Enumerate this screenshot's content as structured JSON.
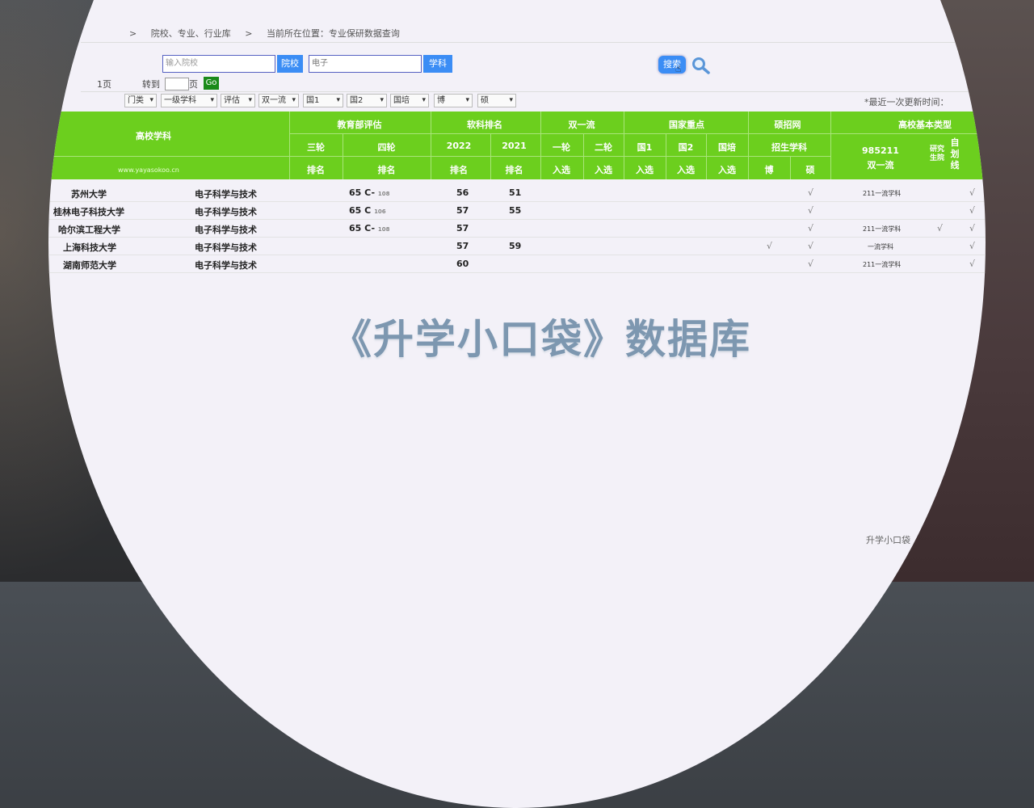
{
  "breadcrumb": {
    "sep1": ">",
    "item1": "院校、专业、行业库",
    "sep2": ">",
    "item2": "当前所在位置：专业保研数据查询"
  },
  "search": {
    "school_placeholder": "输入院校",
    "school_button": "院校",
    "major_value": "电子",
    "major_button": "学科",
    "search_button": "搜索"
  },
  "pager": {
    "page_label": "1页",
    "goto_label": "转到",
    "page_unit": "页",
    "go_button": "Go"
  },
  "filters": [
    "门类",
    "一级学科",
    "评估",
    "双一流",
    "国1",
    "国2",
    "国培",
    "博",
    "硕"
  ],
  "update_label": "*最近一次更新时间：",
  "table": {
    "col_school_major": "高校学科",
    "group_moe": "教育部评估",
    "group_ruanke": "软科排名",
    "group_double": "双一流",
    "group_national": "国家重点",
    "group_shuozhao": "硕招网",
    "group_basic": "高校基本类型",
    "sub_round3": "三轮",
    "sub_round4": "四轮",
    "sub_2022": "2022",
    "sub_2021": "2021",
    "sub_d1": "一轮",
    "sub_d2": "二轮",
    "sub_n1": "国1",
    "sub_n2": "国2",
    "sub_n3": "国培",
    "sub_enroll": "招生学科",
    "sub_985": "985211",
    "sub_double": "双一流",
    "sub_grad": "研究生院",
    "sub_self": "自划线",
    "r_rank1": "排名",
    "r_rank2": "排名",
    "r_rank3": "排名",
    "r_rank4": "排名",
    "r_sel1": "入选",
    "r_sel2": "入选",
    "r_sel3": "入选",
    "r_sel4": "入选",
    "r_sel5": "入选",
    "r_bo": "博",
    "r_shuo": "硕",
    "website": "www.yayasokoo.cn"
  },
  "rows": [
    {
      "school": "苏州大学",
      "major": "电子科学与技术",
      "r4": "65 C-",
      "r4_small": "108",
      "y2022": "56",
      "y2021": "51",
      "bo": "",
      "shuo": "√",
      "basic": "211一流学科",
      "grad": "",
      "self": "√"
    },
    {
      "school": "桂林电子科技大学",
      "major": "电子科学与技术",
      "r4": "65 C",
      "r4_small": "106",
      "y2022": "57",
      "y2021": "55",
      "bo": "",
      "shuo": "√",
      "basic": "",
      "grad": "",
      "self": "√"
    },
    {
      "school": "哈尔滨工程大学",
      "major": "电子科学与技术",
      "r4": "65 C-",
      "r4_small": "108",
      "y2022": "57",
      "y2021": "",
      "bo": "",
      "shuo": "√",
      "basic": "211一流学科",
      "grad": "√",
      "self": "√"
    },
    {
      "school": "上海科技大学",
      "major": "电子科学与技术",
      "r4": "",
      "r4_small": "",
      "y2022": "57",
      "y2021": "59",
      "bo": "√",
      "shuo": "√",
      "basic": "一流学科",
      "grad": "",
      "self": "√"
    },
    {
      "school": "湖南师范大学",
      "major": "电子科学与技术",
      "r4": "",
      "r4_small": "",
      "y2022": "60",
      "y2021": "",
      "bo": "",
      "shuo": "√",
      "basic": "211一流学科",
      "grad": "",
      "self": "√"
    }
  ],
  "overlay_title": "《升学小口袋》数据库",
  "footer": "升学小口袋"
}
